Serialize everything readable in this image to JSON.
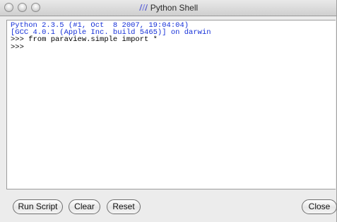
{
  "window": {
    "title": "Python Shell",
    "app_icon": "paraview-icon",
    "controls": [
      "close-button",
      "minimize-button",
      "zoom-button"
    ]
  },
  "console": {
    "lines": [
      {
        "text": "Python 2.3.5 (#1, Oct  8 2007, 19:04:04)",
        "kind": "output"
      },
      {
        "text": "[GCC 4.0.1 (Apple Inc. build 5465)] on darwin",
        "kind": "output"
      },
      {
        "text": ">>> from paraview.simple import *",
        "kind": "input"
      },
      {
        "text": ">>>",
        "kind": "input"
      }
    ],
    "colors": {
      "output": "#1530d8",
      "input": "#000000"
    }
  },
  "buttons": {
    "run_script": "Run Script",
    "clear": "Clear",
    "reset": "Reset",
    "close": "Close"
  }
}
